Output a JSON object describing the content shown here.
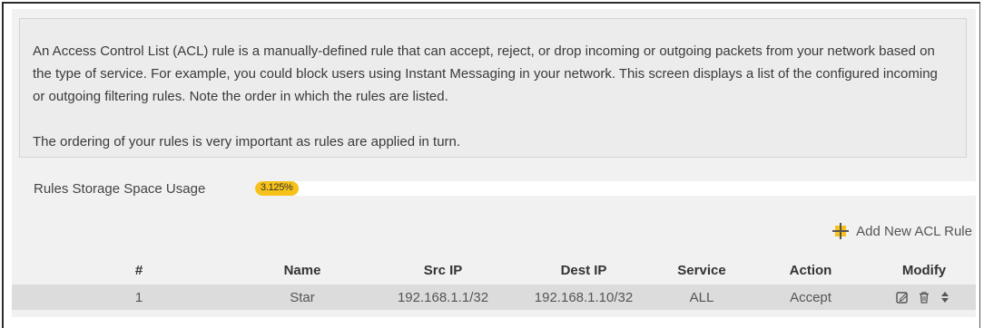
{
  "description": {
    "paragraph1": "An Access Control List (ACL) rule is a manually-defined rule that can accept, reject, or drop incoming or outgoing packets from your network based on the type of service. For example, you could block users using Instant Messaging in your network. This screen displays a list of the configured incoming or outgoing filtering rules. Note the order in which the rules are listed.",
    "paragraph2": "The ordering of your rules is very important as rules are applied in turn."
  },
  "usage": {
    "label": "Rules Storage Space Usage",
    "percent_text": "3.125%",
    "percent": 3.125,
    "fill_color": "#f6c21a"
  },
  "add_rule": {
    "label": "Add New ACL Rule",
    "icon": "plus-icon"
  },
  "table": {
    "headers": [
      "#",
      "Name",
      "Src IP",
      "Dest IP",
      "Service",
      "Action",
      "Modify"
    ],
    "rows": [
      {
        "index": "1",
        "name": "Star",
        "src_ip": "192.168.1.1/32",
        "dest_ip": "192.168.1.10/32",
        "service": "ALL",
        "action": "Accept",
        "modify_icons": [
          "edit-icon",
          "delete-icon",
          "move-icon"
        ]
      }
    ]
  }
}
